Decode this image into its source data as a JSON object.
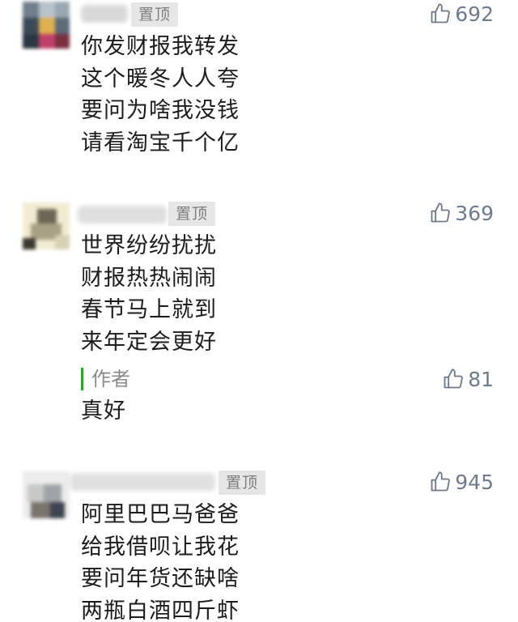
{
  "comments": [
    {
      "pin_label": "置顶",
      "like_count": "692",
      "lines": [
        "你发财报我转发",
        "这个暖冬人人夸",
        "要问为啥我没钱",
        "请看淘宝千个亿"
      ]
    },
    {
      "pin_label": "置顶",
      "like_count": "369",
      "lines": [
        "世界纷纷扰扰",
        "财报热热闹闹",
        "春节马上就到",
        "来年定会更好"
      ],
      "reply": {
        "author_label": "作者",
        "text": "真好",
        "like_count": "81"
      }
    },
    {
      "pin_label": "置顶",
      "like_count": "945",
      "lines": [
        "阿里巴巴马爸爸",
        "给我借呗让我花",
        "要问年货还缺啥",
        "两瓶白酒四斤虾"
      ]
    }
  ],
  "icons": {
    "like": "thumbs-up-icon"
  },
  "colors": {
    "like": "#6e7b8c",
    "author_bar": "#2ca52c",
    "pin_badge_bg": "#e6e6e6",
    "pin_badge_text": "#7d7d7d",
    "body_text": "#1c1c1c"
  }
}
